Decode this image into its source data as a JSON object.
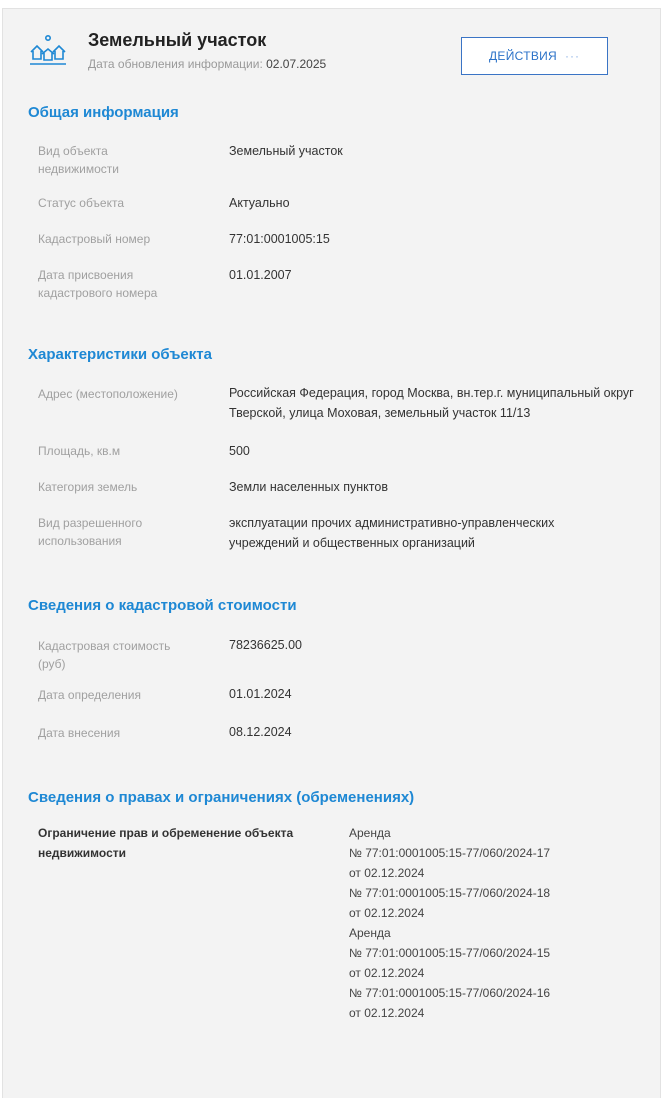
{
  "header": {
    "title": "Земельный участок",
    "updated_label": "Дата обновления информации:",
    "updated_date": "02.07.2025",
    "actions_label": "ДЕЙСТВИЯ",
    "actions_dots": "···",
    "icon": "land-plot-icon"
  },
  "colors": {
    "accent": "#1e88d4",
    "button_border": "#3a74c5",
    "label": "#a0a0a0"
  },
  "general": {
    "title": "Общая информация",
    "rows": [
      {
        "label": "Вид объекта недвижимости",
        "value": "Земельный участок"
      },
      {
        "label": "Статус объекта",
        "value": "Актуально"
      },
      {
        "label": "Кадастровый номер",
        "value": "77:01:0001005:15"
      },
      {
        "label": "Дата присвоения кадастрового номера",
        "value": "01.01.2007"
      }
    ]
  },
  "characteristics": {
    "title": "Характеристики объекта",
    "rows": [
      {
        "label": "Адрес (местоположение)",
        "value": "Российская Федерация, город Москва, вн.тер.г. муниципальный округ Тверской, улица Моховая, земельный участок 11/13"
      },
      {
        "label": "Площадь, кв.м",
        "value": "500"
      },
      {
        "label": "Категория земель",
        "value": "Земли населенных пунктов"
      },
      {
        "label": "Вид разрешенного использования",
        "value": "эксплуатации прочих административно-управленческих учреждений и общественных организаций"
      }
    ]
  },
  "cadastral_value": {
    "title": "Сведения о кадастровой стоимости",
    "rows": [
      {
        "label": "Кадастровая стоимость (руб)",
        "value": "78236625.00"
      },
      {
        "label": "Дата определения",
        "value": "01.01.2024"
      },
      {
        "label": "Дата внесения",
        "value": "08.12.2024"
      }
    ]
  },
  "rights": {
    "title": "Сведения о правах и ограничениях (обременениях)",
    "label": "Ограничение прав и обременение объекта недвижимости",
    "entries": [
      {
        "type": "Аренда",
        "number": "№ 77:01:0001005:15-77/060/2024-17",
        "date": "от 02.12.2024"
      },
      {
        "type": "",
        "number": "№ 77:01:0001005:15-77/060/2024-18",
        "date": "от 02.12.2024"
      },
      {
        "type": "Аренда",
        "number": "№ 77:01:0001005:15-77/060/2024-15",
        "date": "от 02.12.2024"
      },
      {
        "type": "",
        "number": "№ 77:01:0001005:15-77/060/2024-16",
        "date": "от 02.12.2024"
      }
    ]
  }
}
